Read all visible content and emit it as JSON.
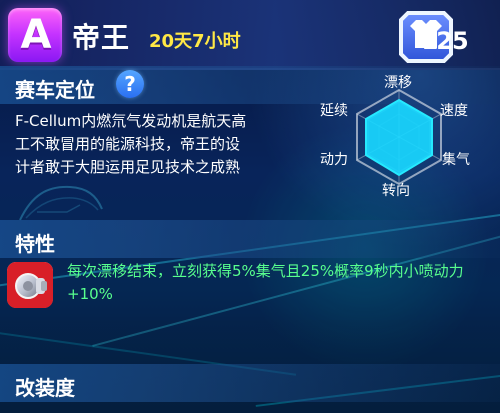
{
  "header": {
    "rank": "A",
    "name": "帝王",
    "duration": "20天7小时",
    "level_text": "25",
    "level_prefix": "L"
  },
  "sections": {
    "positioning_title": "赛车定位",
    "traits_title": "特性",
    "modification_title": "改装度"
  },
  "positioning": {
    "description": "F-Cellum内燃氘气发动机是航天高\n工不敢冒用的能源科技，帝王的设\n计者敢于大胆运用足见技术之成熟",
    "radar_labels": {
      "top": "漂移",
      "top_left": "延续",
      "top_right": "速度",
      "left": "动力",
      "right": "集气",
      "bottom": "转向"
    }
  },
  "trait": {
    "text": "每次漂移结束，立刻获得5%集气且25%概率9秒内小喷动力+10%"
  },
  "icons": {
    "help": "?"
  },
  "colors": {
    "rank_badge": "#c533ff",
    "duration": "#ffe845",
    "trait_text": "#58ff8e",
    "radar_fill": "#19d7ff",
    "section_bar": "#184e90"
  }
}
